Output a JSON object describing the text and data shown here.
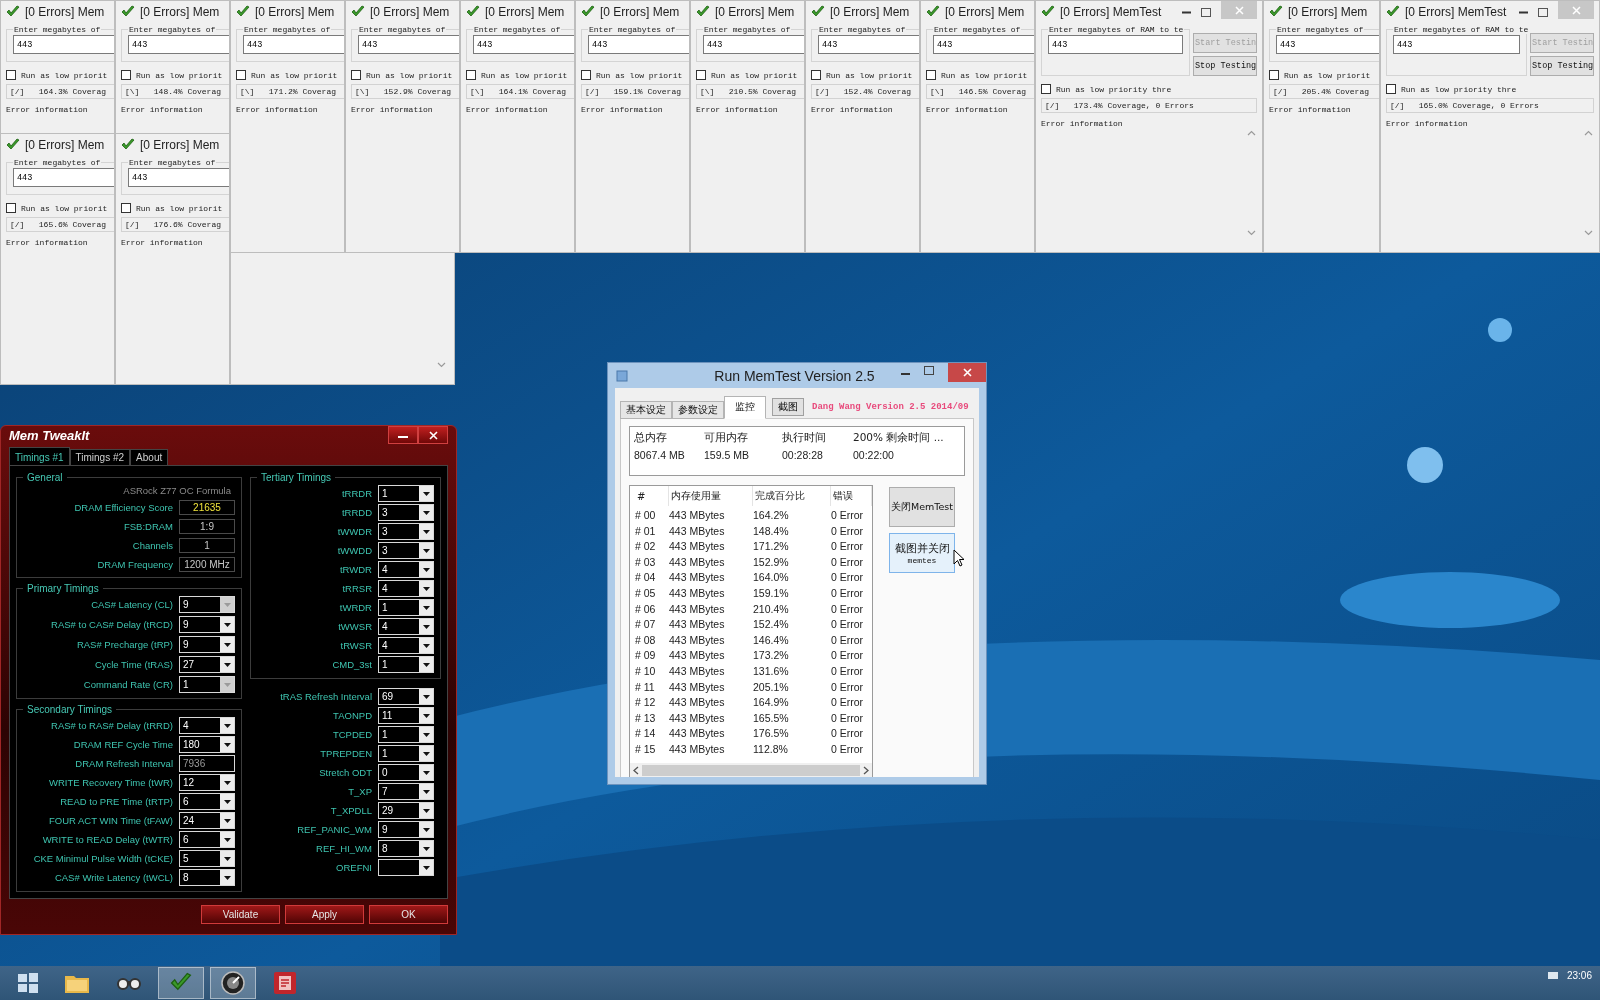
{
  "memtest_windows": [
    {
      "kind": "narrow",
      "title": "[0 Errors] Mem",
      "prompt": "Enter megabytes of",
      "value": "443",
      "checkbox": {
        "label": "Run as low priorit",
        "checked": false
      },
      "status": "[/]   164.3% Coverag",
      "error_label": "Error information"
    },
    {
      "kind": "narrow",
      "title": "[0 Errors] Mem",
      "prompt": "Enter megabytes of",
      "value": "443",
      "checkbox": {
        "label": "Run as low priorit",
        "checked": false
      },
      "status": "[\\]   148.4% Coverag",
      "error_label": "Error information"
    },
    {
      "kind": "narrow",
      "title": "[0 Errors] Mem",
      "prompt": "Enter megabytes of",
      "value": "443",
      "checkbox": {
        "label": "Run as low priorit",
        "checked": false
      },
      "status": "[\\]   171.2% Coverag",
      "error_label": "Error information"
    },
    {
      "kind": "narrow",
      "title": "[0 Errors] Mem",
      "prompt": "Enter megabytes of",
      "value": "443",
      "checkbox": {
        "label": "Run as low priorit",
        "checked": false
      },
      "status": "[\\]   152.9% Coverag",
      "error_label": "Error information"
    },
    {
      "kind": "narrow",
      "title": "[0 Errors] Mem",
      "prompt": "Enter megabytes of",
      "value": "443",
      "checkbox": {
        "label": "Run as low priorit",
        "checked": false
      },
      "status": "[\\]   164.1% Coverag",
      "error_label": "Error information"
    },
    {
      "kind": "narrow",
      "title": "[0 Errors] Mem",
      "prompt": "Enter megabytes of",
      "value": "443",
      "checkbox": {
        "label": "Run as low priorit",
        "checked": false
      },
      "status": "[/]   159.1% Coverag",
      "error_label": "Error information"
    },
    {
      "kind": "narrow",
      "title": "[0 Errors] Mem",
      "prompt": "Enter megabytes of",
      "value": "443",
      "checkbox": {
        "label": "Run as low priorit",
        "checked": false
      },
      "status": "[\\]   210.5% Coverag",
      "error_label": "Error information"
    },
    {
      "kind": "narrow",
      "title": "[0 Errors] Mem",
      "prompt": "Enter megabytes of",
      "value": "443",
      "checkbox": {
        "label": "Run as low priorit",
        "checked": false
      },
      "status": "[/]   152.4% Coverag",
      "error_label": "Error information"
    },
    {
      "kind": "narrow",
      "title": "[0 Errors] Mem",
      "prompt": "Enter megabytes of",
      "value": "443",
      "checkbox": {
        "label": "Run as low priorit",
        "checked": false
      },
      "status": "[\\]   146.5% Coverag",
      "error_label": "Error information"
    },
    {
      "kind": "wide",
      "title": "[0 Errors] MemTest",
      "prompt": "Enter megabytes of RAM to te",
      "value": "443",
      "buttons": [
        {
          "label": "Start Testin",
          "disabled": true
        },
        {
          "label": "Stop Testing",
          "disabled": false
        }
      ],
      "checkbox": {
        "label": "Run as low priority thre",
        "checked": false
      },
      "status": "[/]   173.4% Coverage, 0 Errors",
      "error_label": "Error information"
    },
    {
      "kind": "narrow",
      "title": "[0 Errors] Mem",
      "prompt": "Enter megabytes of",
      "value": "443",
      "checkbox": {
        "label": "Run as low priorit",
        "checked": false
      },
      "status": "[/]   205.4% Coverag",
      "error_label": "Error information"
    },
    {
      "kind": "wide",
      "title": "[0 Errors] MemTest",
      "prompt": "Enter megabytes of RAM to te",
      "value": "443",
      "buttons": [
        {
          "label": "Start Testin",
          "disabled": true
        },
        {
          "label": "Stop Testing",
          "disabled": false
        }
      ],
      "checkbox": {
        "label": "Run as low priority thre",
        "checked": false
      },
      "status": "[/]   165.0% Coverage, 0 Errors",
      "error_label": "Error information"
    },
    {
      "kind": "narrow",
      "title": "[0 Errors] Mem",
      "prompt": "Enter megabytes of",
      "value": "443",
      "checkbox": {
        "label": "Run as low priorit",
        "checked": false
      },
      "status": "[/]   165.6% Coverag",
      "error_label": "Error information"
    },
    {
      "kind": "narrow",
      "title": "[0 Errors] Mem",
      "prompt": "Enter megabytes of",
      "value": "443",
      "checkbox": {
        "label": "Run as low priorit",
        "checked": false
      },
      "status": "[/]   176.6% Coverag",
      "error_label": "Error information"
    }
  ],
  "mem_tweakit": {
    "title": "Mem TweakIt",
    "tabs": [
      {
        "label": "Timings #1",
        "selected": true
      },
      {
        "label": "Timings #2",
        "selected": false
      },
      {
        "label": "About",
        "selected": false
      }
    ],
    "general": {
      "title": "General",
      "board": "ASRock Z77 OC Formula",
      "fields": [
        {
          "label": "DRAM Efficiency Score",
          "value": "21635",
          "kind": "display",
          "color": "#f0e43c"
        },
        {
          "label": "FSB:DRAM",
          "value": "1:9",
          "kind": "display"
        },
        {
          "label": "Channels",
          "value": "1",
          "kind": "display"
        },
        {
          "label": "DRAM Frequency",
          "value": "1200 MHz",
          "kind": "display"
        }
      ]
    },
    "primary": {
      "title": "Primary Timings",
      "fields": [
        {
          "label": "CAS# Latency (CL)",
          "value": "9",
          "kind": "select",
          "disabled": true
        },
        {
          "label": "RAS# to CAS# Delay (tRCD)",
          "value": "9",
          "kind": "select",
          "disabled": false
        },
        {
          "label": "RAS# Precharge (tRP)",
          "value": "9",
          "kind": "select",
          "disabled": false
        },
        {
          "label": "Cycle Time (tRAS)",
          "value": "27",
          "kind": "select",
          "disabled": false
        },
        {
          "label": "Command Rate (CR)",
          "value": "1",
          "kind": "select",
          "disabled": true
        }
      ]
    },
    "secondary": {
      "title": "Secondary Timings",
      "fields": [
        {
          "label": "RAS# to RAS# Delay (tRRD)",
          "value": "4",
          "kind": "select",
          "disabled": false
        },
        {
          "label": "DRAM REF Cycle Time",
          "value": "180",
          "kind": "select",
          "disabled": false
        },
        {
          "label": "DRAM Refresh Interval",
          "value": "7936",
          "kind": "input",
          "disabled": true
        },
        {
          "label": "WRITE Recovery Time (tWR)",
          "value": "12",
          "kind": "select",
          "disabled": false
        },
        {
          "label": "READ to PRE Time (tRTP)",
          "value": "6",
          "kind": "select",
          "disabled": false
        },
        {
          "label": "FOUR ACT WIN Time (tFAW)",
          "value": "24",
          "kind": "select",
          "disabled": false
        },
        {
          "label": "WRITE to READ Delay (tWTR)",
          "value": "6",
          "kind": "select",
          "disabled": false
        },
        {
          "label": "CKE Minimul Pulse Width (tCKE)",
          "value": "5",
          "kind": "select",
          "disabled": false
        },
        {
          "label": "CAS# Write Latency (tWCL)",
          "value": "8",
          "kind": "select",
          "disabled": false
        }
      ]
    },
    "tertiary": {
      "title": "Tertiary Timings",
      "fields": [
        {
          "label": "tRRDR",
          "value": "1",
          "kind": "select",
          "disabled": false
        },
        {
          "label": "tRRDD",
          "value": "3",
          "kind": "select",
          "disabled": false
        },
        {
          "label": "tWWDR",
          "value": "3",
          "kind": "select",
          "disabled": false
        },
        {
          "label": "tWWDD",
          "value": "3",
          "kind": "select",
          "disabled": false
        },
        {
          "label": "tRWDR",
          "value": "4",
          "kind": "select",
          "disabled": false
        },
        {
          "label": "tRRSR",
          "value": "4",
          "kind": "select",
          "disabled": false
        },
        {
          "label": "tWRDR",
          "value": "1",
          "kind": "select",
          "disabled": false
        },
        {
          "label": "tWWSR",
          "value": "4",
          "kind": "select",
          "disabled": false
        },
        {
          "label": "tRWSR",
          "value": "4",
          "kind": "select",
          "disabled": false
        },
        {
          "label": "CMD_3st",
          "value": "1",
          "kind": "select",
          "disabled": false
        }
      ]
    },
    "other": {
      "fields": [
        {
          "label": "tRAS Refresh Interval",
          "value": "69",
          "kind": "select",
          "disabled": false
        },
        {
          "label": "TAONPD",
          "value": "11",
          "kind": "select",
          "disabled": false
        },
        {
          "label": "TCPDED",
          "value": "1",
          "kind": "select",
          "disabled": false
        },
        {
          "label": "TPREPDEN",
          "value": "1",
          "kind": "select",
          "disabled": false
        },
        {
          "label": "Stretch ODT",
          "value": "0",
          "kind": "select",
          "disabled": false
        },
        {
          "label": "T_XP",
          "value": "7",
          "kind": "select",
          "disabled": false
        },
        {
          "label": "T_XPDLL",
          "value": "29",
          "kind": "select",
          "disabled": false
        },
        {
          "label": "REF_PANIC_WM",
          "value": "9",
          "kind": "select",
          "disabled": false
        },
        {
          "label": "REF_HI_WM",
          "value": "8",
          "kind": "select",
          "disabled": false
        },
        {
          "label": "OREFNI",
          "kind": "select",
          "disabled": false
        }
      ]
    },
    "buttons": [
      "Validate",
      "Apply",
      "OK"
    ]
  },
  "run_memtest": {
    "title": "Run MemTest Version 2.5",
    "tabs": [
      {
        "label": "基本设定",
        "selected": false
      },
      {
        "label": "参数设定",
        "selected": false
      },
      {
        "label": "监控",
        "selected": true
      }
    ],
    "snapshot_button": "截图",
    "version_note": "Dang Wang Version 2.5 2014/09",
    "summary": {
      "columns": [
        "总内存",
        "可用内存",
        "执行时间",
        "200% 剩余时间 ..."
      ],
      "values": [
        "8067.4 MB",
        "159.5 MB",
        "00:28:28",
        "00:22:00"
      ]
    },
    "table": {
      "columns": [
        "#",
        "内存使用量",
        "完成百分比",
        "错误"
      ],
      "rows": [
        [
          "# 00",
          "443 MBytes",
          "164.2%",
          "0 Error"
        ],
        [
          "# 01",
          "443 MBytes",
          "148.4%",
          "0 Error"
        ],
        [
          "# 02",
          "443 MBytes",
          "171.2%",
          "0 Error"
        ],
        [
          "# 03",
          "443 MBytes",
          "152.9%",
          "0 Error"
        ],
        [
          "# 04",
          "443 MBytes",
          "164.0%",
          "0 Error"
        ],
        [
          "# 05",
          "443 MBytes",
          "159.1%",
          "0 Error"
        ],
        [
          "# 06",
          "443 MBytes",
          "210.4%",
          "0 Error"
        ],
        [
          "# 07",
          "443 MBytes",
          "152.4%",
          "0 Error"
        ],
        [
          "# 08",
          "443 MBytes",
          "146.4%",
          "0 Error"
        ],
        [
          "# 09",
          "443 MBytes",
          "173.2%",
          "0 Error"
        ],
        [
          "# 10",
          "443 MBytes",
          "131.6%",
          "0 Error"
        ],
        [
          "# 11",
          "443 MBytes",
          "205.1%",
          "0 Error"
        ],
        [
          "# 12",
          "443 MBytes",
          "164.9%",
          "0 Error"
        ],
        [
          "# 13",
          "443 MBytes",
          "165.5%",
          "0 Error"
        ],
        [
          "# 14",
          "443 MBytes",
          "176.5%",
          "0 Error"
        ],
        [
          "# 15",
          "443 MBytes",
          "112.8%",
          "0 Error"
        ]
      ]
    },
    "buttons": [
      {
        "label": "关闭MemTest",
        "hovered": false
      },
      {
        "label": "截图并关闭",
        "sublabel": "memtes",
        "hovered": true
      }
    ]
  },
  "taskbar": {
    "apps": [
      {
        "kind": "folder",
        "active": false
      },
      {
        "kind": "binoculars",
        "active": false
      },
      {
        "kind": "memtest",
        "active": true
      },
      {
        "kind": "memtweakit",
        "active": true
      },
      {
        "kind": "runmemtest",
        "active": false
      }
    ],
    "clock": "23:06"
  }
}
